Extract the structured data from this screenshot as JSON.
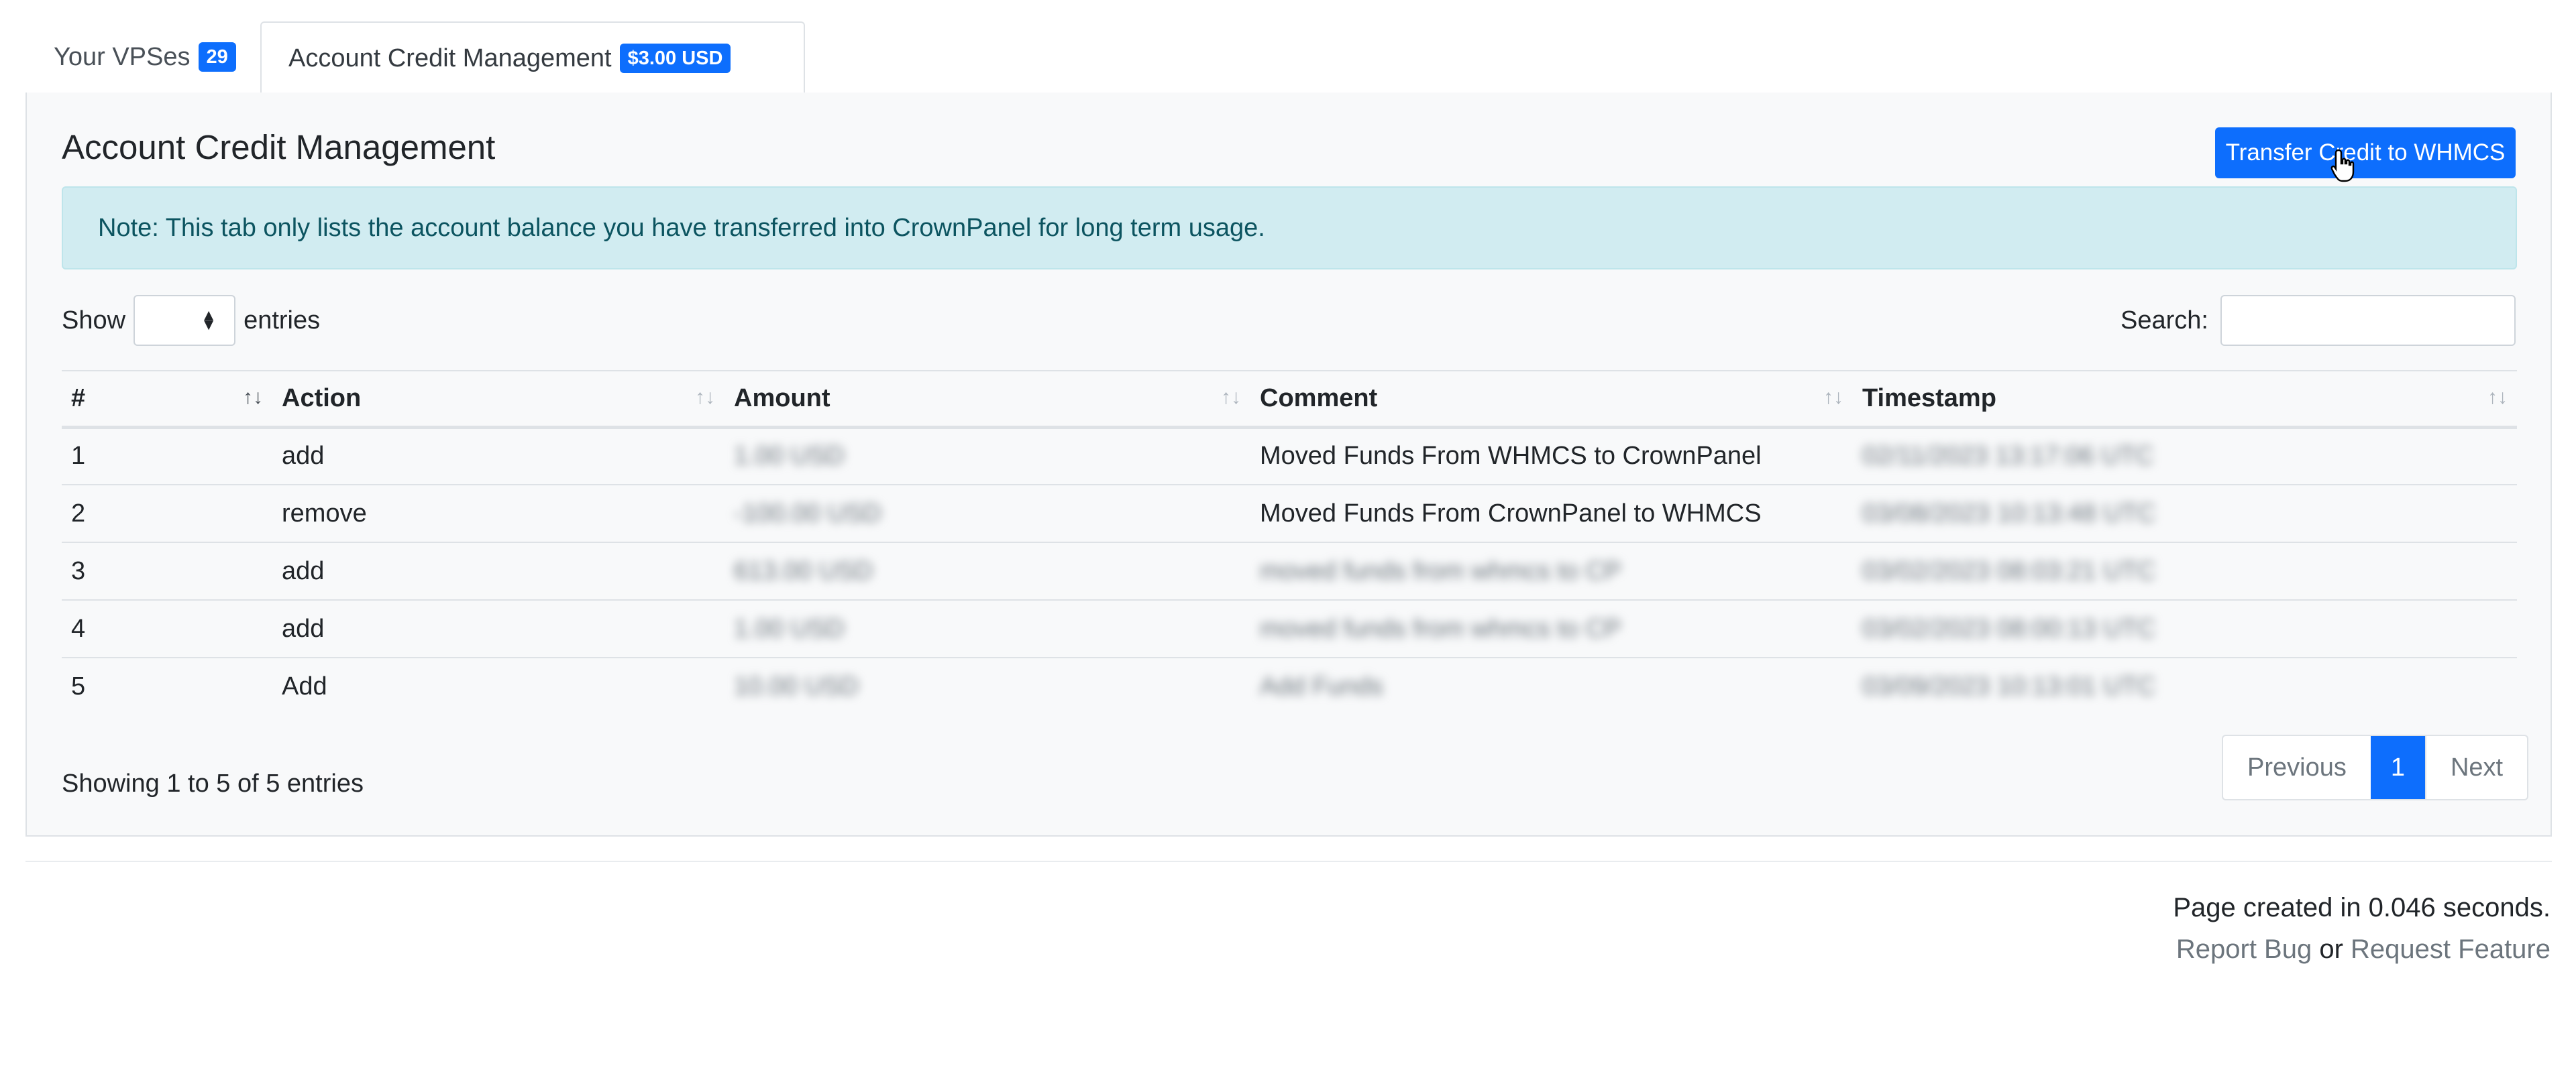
{
  "tabs": {
    "vps_label": "Your VPSes",
    "vps_count": "29",
    "credit_label": "Account Credit Management",
    "credit_balance": "$3.00 USD"
  },
  "card": {
    "title": "Account Credit Management",
    "transfer_button": "Transfer Credit to WHMCS",
    "note": "Note: This tab only lists the account balance you have transferred into CrownPanel for long term usage."
  },
  "controls": {
    "show_label": "Show",
    "entries_label": "entries",
    "search_label": "Search:"
  },
  "table": {
    "headers": [
      "#",
      "Action",
      "Amount",
      "Comment",
      "Timestamp"
    ],
    "rows": [
      {
        "num": "1",
        "action": "add",
        "amount": "1.00 USD",
        "comment": "Moved Funds From WHMCS to CrownPanel",
        "timestamp": "02/11/2023 13:17:06 UTC"
      },
      {
        "num": "2",
        "action": "remove",
        "amount": "-100.00 USD",
        "comment": "Moved Funds From CrownPanel to WHMCS",
        "timestamp": "03/08/2023 10:13:48 UTC"
      },
      {
        "num": "3",
        "action": "add",
        "amount": "613.00 USD",
        "comment": "moved funds from whmcs to CP",
        "timestamp": "03/02/2023 08:03:21 UTC"
      },
      {
        "num": "4",
        "action": "add",
        "amount": "1.00 USD",
        "comment": "moved funds from whmcs to CP",
        "timestamp": "03/02/2023 08:00:13 UTC"
      },
      {
        "num": "5",
        "action": "Add",
        "amount": "10.00 USD",
        "comment": "Add Funds",
        "timestamp": "03/09/2023 10:13:01 UTC"
      }
    ]
  },
  "pagination": {
    "info": "Showing 1 to 5 of 5 entries",
    "previous": "Previous",
    "current": "1",
    "next": "Next"
  },
  "footer": {
    "page_time": "Page created in 0.046 seconds.",
    "report_bug": "Report Bug",
    "or": "or",
    "request_feature": "Request Feature"
  },
  "colors": {
    "primary": "#0d6efd",
    "alert_bg": "#d1ecf1",
    "alert_text": "#0c5460"
  }
}
